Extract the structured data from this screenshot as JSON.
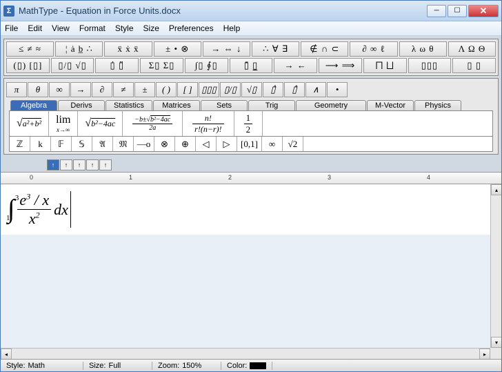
{
  "window": {
    "app_name": "MathType",
    "doc_name": "Equation in Force Units.docx"
  },
  "menu": [
    "File",
    "Edit",
    "View",
    "Format",
    "Style",
    "Size",
    "Preferences",
    "Help"
  ],
  "palette_row1": [
    "≤ ≠ ≈",
    "¦ ȧ b̲ ∴",
    "ẍ ẋ ẍ",
    "± • ⊗",
    "→ ⇔ ↓",
    "∴ ∀ ∃",
    "∉ ∩ ⊂",
    "∂ ∞ ℓ",
    "λ ω θ",
    "Λ Ω Θ"
  ],
  "palette_row2": [
    "(▯) [▯]",
    "▯/▯ √▯",
    "▯̇ ▯̈",
    "Σ▯ Σ▯",
    "∫▯ ∮▯",
    "▯̄ ▯̲",
    "→ ←",
    "⟶ ⟹",
    "⨅ ⨆",
    "▯▯▯",
    "▯ ▯"
  ],
  "symbol_row": [
    "π",
    "θ",
    "∞",
    "→",
    "∂",
    "≠",
    "±",
    "( )",
    "[ ]",
    "▯▯▯",
    "▯/▯",
    "√▯",
    "▯̂",
    "▯̂",
    "∧",
    "•"
  ],
  "tabs": [
    "Algebra",
    "Derivs",
    "Statistics",
    "Matrices",
    "Sets",
    "Trig",
    "Geometry",
    "M-Vector",
    "Physics"
  ],
  "active_tab": 0,
  "templates": {
    "sqrt_ab": "√(a²+b²)",
    "lim": "lim_{x→∞}",
    "quad_sqrt": "√(b²−4ac)",
    "quad_full": "(−b±√(b²−4ac)) / 2a",
    "binom": "n! / r!(n−r)!",
    "half": "1/2"
  },
  "symbol_bar2": [
    "ℤ",
    "k",
    "𝔽",
    "𝕊",
    "𝔄",
    "𝔐",
    "—o",
    "⊗",
    "⊕",
    "◁",
    "▷",
    "[0,1]",
    "∞",
    "√2"
  ],
  "arrow_btns": [
    "↑",
    "↑",
    "↑",
    "↑",
    "↑"
  ],
  "ruler_ticks": [
    "0",
    "1",
    "2",
    "3",
    "4"
  ],
  "equation": {
    "int_lower": "1",
    "int_upper": "3",
    "numerator": "e³ / x",
    "denominator": "x²",
    "suffix": "dx"
  },
  "status": {
    "style_lbl": "Style:",
    "style_val": "Math",
    "size_lbl": "Size:",
    "size_val": "Full",
    "zoom_lbl": "Zoom:",
    "zoom_val": "150%",
    "color_lbl": "Color:"
  }
}
